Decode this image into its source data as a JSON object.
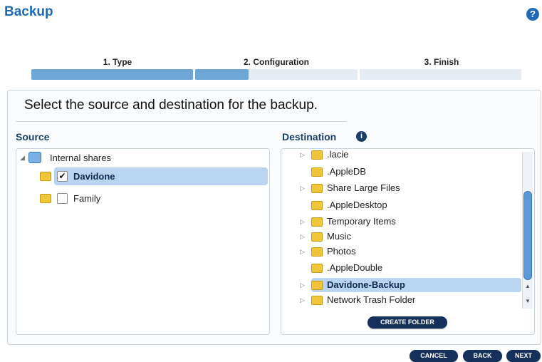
{
  "header": {
    "title": "Backup",
    "help_label": "?"
  },
  "steps": [
    {
      "label": "1. Type"
    },
    {
      "label": "2. Configuration"
    },
    {
      "label": "3. Finish"
    }
  ],
  "instruction": "Select the source and destination for the backup.",
  "source": {
    "title": "Source",
    "root_label": "Internal shares",
    "items": [
      {
        "label": "Davidone",
        "checked": true
      },
      {
        "label": "Family",
        "checked": false
      }
    ]
  },
  "destination": {
    "title": "Destination",
    "info_label": "i",
    "items": [
      {
        "label": ".lacie"
      },
      {
        "label": ".AppleDB"
      },
      {
        "label": "Share Large Files"
      },
      {
        "label": ".AppleDesktop"
      },
      {
        "label": "Temporary Items"
      },
      {
        "label": "Music"
      },
      {
        "label": "Photos"
      },
      {
        "label": ".AppleDouble"
      },
      {
        "label": "Davidone-Backup"
      },
      {
        "label": "Network Trash Folder"
      }
    ],
    "create_folder_label": "CREATE FOLDER"
  },
  "footer": {
    "cancel_label": "CANCEL",
    "back_label": "BACK",
    "next_label": "NEXT"
  }
}
